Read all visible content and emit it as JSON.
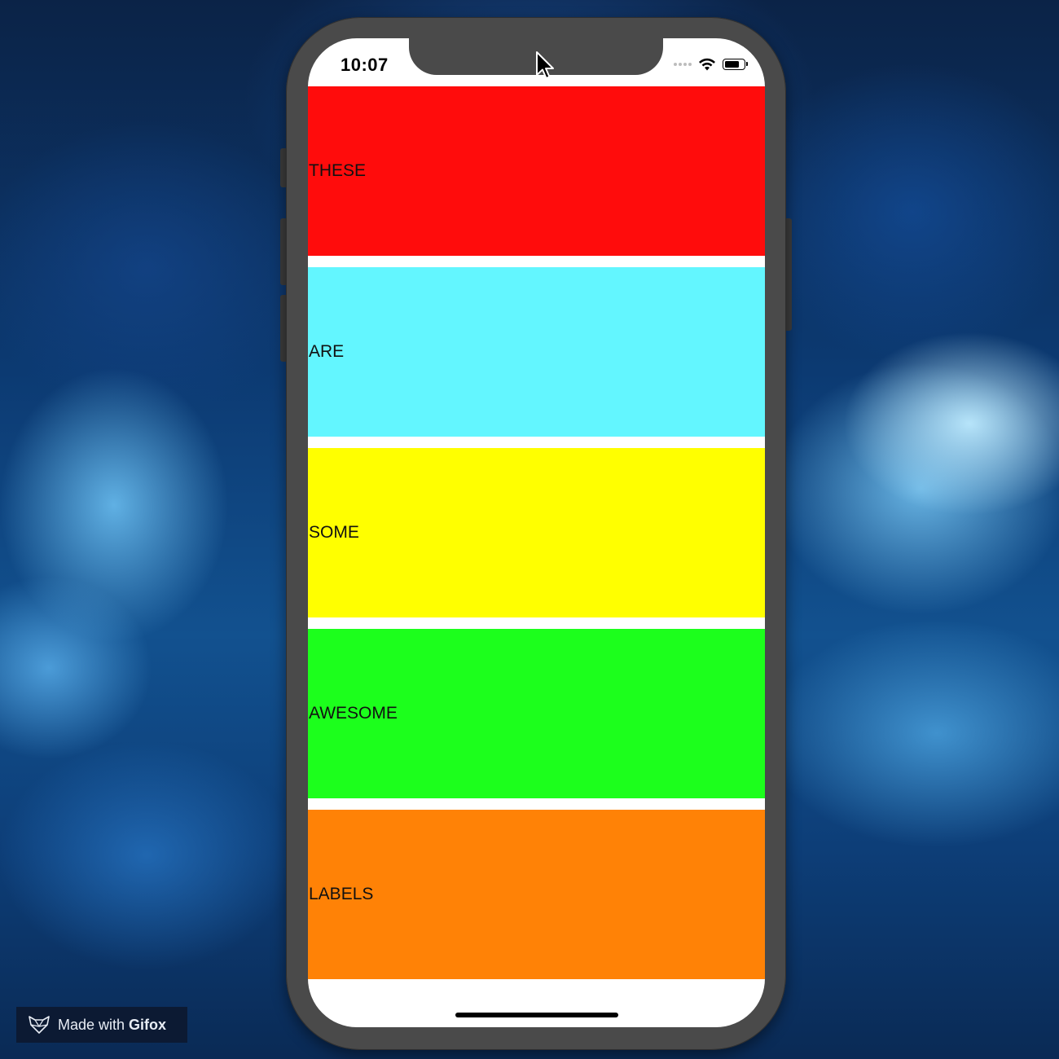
{
  "colors": {
    "phone_frame": "#4a4a4a",
    "screen_bg": "#ffffff"
  },
  "status_bar": {
    "time": "10:07",
    "icons": [
      "cellular-signal-icon",
      "wifi-icon",
      "battery-icon"
    ]
  },
  "labels": [
    {
      "text": "THESE",
      "color": "#ff0c0c"
    },
    {
      "text": "ARE",
      "color": "#63f6ff"
    },
    {
      "text": "SOME",
      "color": "#ffff00"
    },
    {
      "text": "AWESOME",
      "color": "#1cff1c"
    },
    {
      "text": "LABELS",
      "color": "#ff8206"
    }
  ],
  "watermark": {
    "prefix": "Made with ",
    "brand": "Gifox",
    "icon": "gifox-fox-icon"
  }
}
